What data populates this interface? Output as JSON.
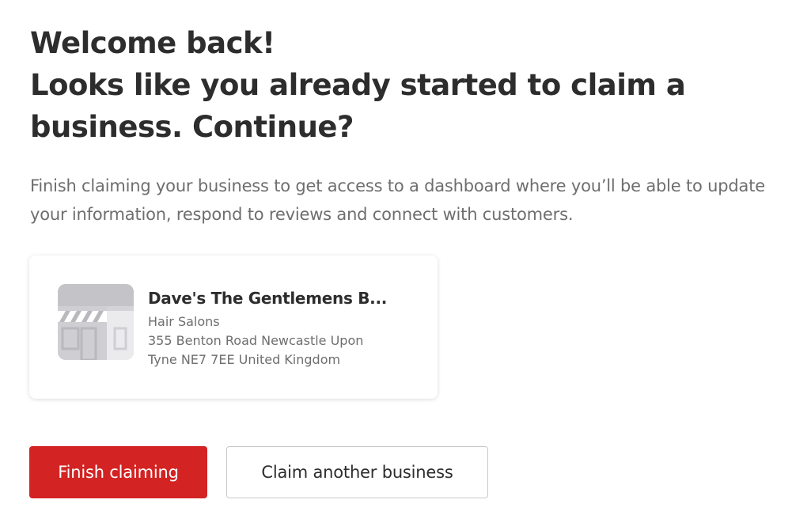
{
  "header": {
    "title_line1": "Welcome back!",
    "title_line2": "Looks like you already started to claim a",
    "title_line3": "business. Continue?"
  },
  "description": "Finish claiming your business to get access to a dashboard where you’ll be able to update your information, respond to reviews and connect with customers.",
  "business": {
    "name": "Dave's The Gentlemens B...",
    "category": "Hair Salons",
    "address_line1": "355 Benton Road Newcastle Upon",
    "address_line2": "Tyne NE7 7EE United Kingdom",
    "thumbnail_icon": "storefront-icon"
  },
  "actions": {
    "primary_label": "Finish claiming",
    "secondary_label": "Claim another business"
  },
  "colors": {
    "primary": "#d32323",
    "text_dark": "#2d2d2d",
    "text_muted": "#6e6e6e",
    "border": "#c8c9ca"
  }
}
